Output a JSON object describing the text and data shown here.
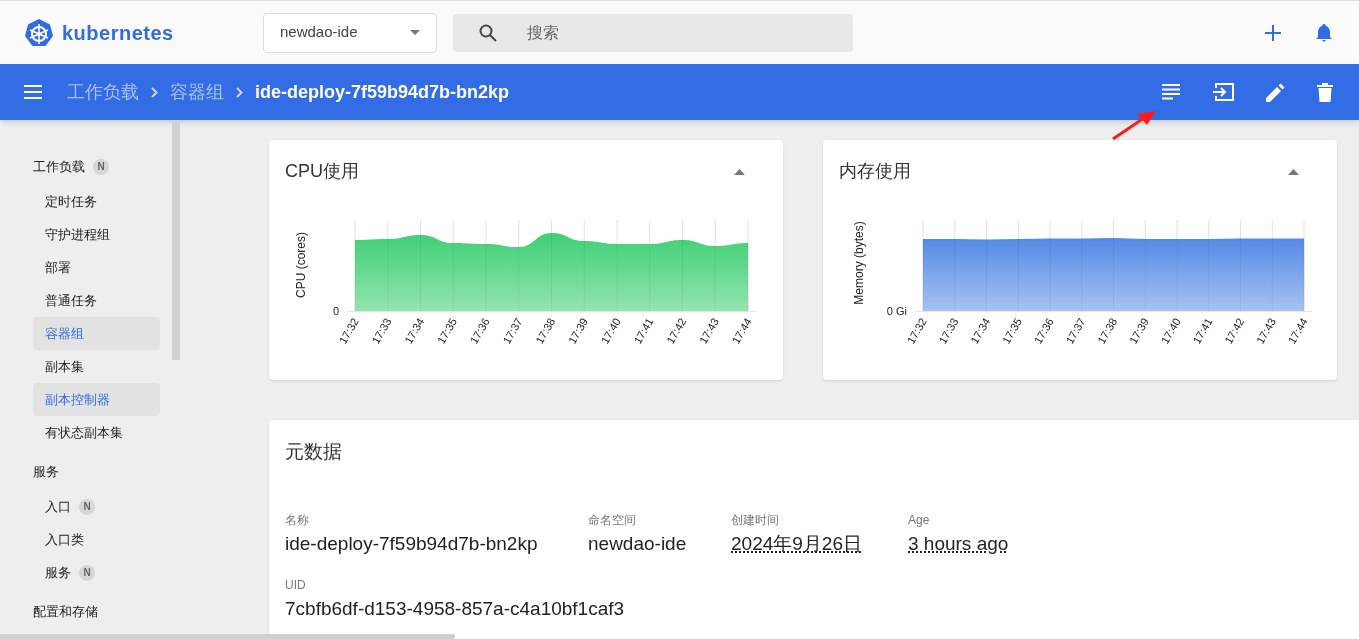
{
  "header": {
    "logo_text": "kubernetes",
    "namespace": "newdao-ide",
    "search": {
      "placeholder": "搜索"
    }
  },
  "breadcrumbs": [
    {
      "label": "工作负载",
      "current": false
    },
    {
      "label": "容器组",
      "current": false
    },
    {
      "label": "ide-deploy-7f59b94d7b-bn2kp",
      "current": true
    }
  ],
  "sidebar": {
    "sections": [
      {
        "label": "工作负载",
        "badge": "N",
        "items": [
          {
            "label": "定时任务",
            "selected": false
          },
          {
            "label": "守护进程组",
            "selected": false
          },
          {
            "label": "部署",
            "selected": false
          },
          {
            "label": "普通任务",
            "selected": false
          },
          {
            "label": "容器组",
            "selected": true
          },
          {
            "label": "副本集",
            "selected": false
          },
          {
            "label": "副本控制器",
            "selected": true
          },
          {
            "label": "有状态副本集",
            "selected": false
          }
        ]
      },
      {
        "label": "服务",
        "items": [
          {
            "label": "入口",
            "badge": "N",
            "selected": false
          },
          {
            "label": "入口类",
            "selected": false
          },
          {
            "label": "服务",
            "badge": "N",
            "selected": false
          }
        ]
      },
      {
        "label": "配置和存储"
      }
    ]
  },
  "charts": [
    {
      "kind": "cpu",
      "title": "CPU使用",
      "y_axis_label": "CPU (cores)",
      "zero_label": "0",
      "x_labels": [
        "17:32",
        "17:33",
        "17:34",
        "17:35",
        "17:36",
        "17:37",
        "17:38",
        "17:39",
        "17:40",
        "17:41",
        "17:42",
        "17:43",
        "17:44"
      ]
    },
    {
      "kind": "memory",
      "title": "内存使用",
      "y_axis_label": "Memory (bytes)",
      "zero_label": "0 Gi",
      "x_labels": [
        "17:32",
        "17:33",
        "17:34",
        "17:35",
        "17:36",
        "17:37",
        "17:38",
        "17:39",
        "17:40",
        "17:41",
        "17:42",
        "17:43",
        "17:44"
      ]
    }
  ],
  "metadata": {
    "title": "元数据",
    "fields": [
      {
        "kind": "plain",
        "label": "名称",
        "value": "ide-deploy-7f59b94d7b-bn2kp"
      },
      {
        "kind": "plain",
        "label": "命名空间",
        "value": "newdao-ide"
      },
      {
        "kind": "dotted",
        "label": "创建时间",
        "value": "2024年9月26日"
      },
      {
        "kind": "dotted",
        "label": "Age",
        "value": "3 hours ago"
      }
    ],
    "uid": {
      "label": "UID",
      "value": "7cbfb6df-d153-4958-857a-c4a10bf1caf3"
    }
  }
}
